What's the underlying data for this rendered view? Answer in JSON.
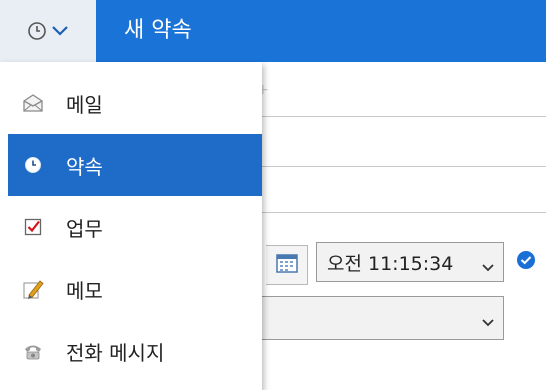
{
  "header": {
    "title": "새 약속",
    "type_button_icon": "clock-icon",
    "accent_color": "#1a73d6"
  },
  "type_menu": {
    "items": [
      {
        "label": "메일",
        "icon": "envelope-icon",
        "selected": false
      },
      {
        "label": "약속",
        "icon": "clock-icon",
        "selected": true
      },
      {
        "label": "업무",
        "icon": "checkbox-icon",
        "selected": false
      },
      {
        "label": "메모",
        "icon": "pencil-icon",
        "selected": false
      },
      {
        "label": "전화 메시지",
        "icon": "phone-icon",
        "selected": false
      }
    ],
    "selected_color": "#1e6cc8"
  },
  "form": {
    "time_value": "오전 11:15:34",
    "faint_text": "+"
  }
}
